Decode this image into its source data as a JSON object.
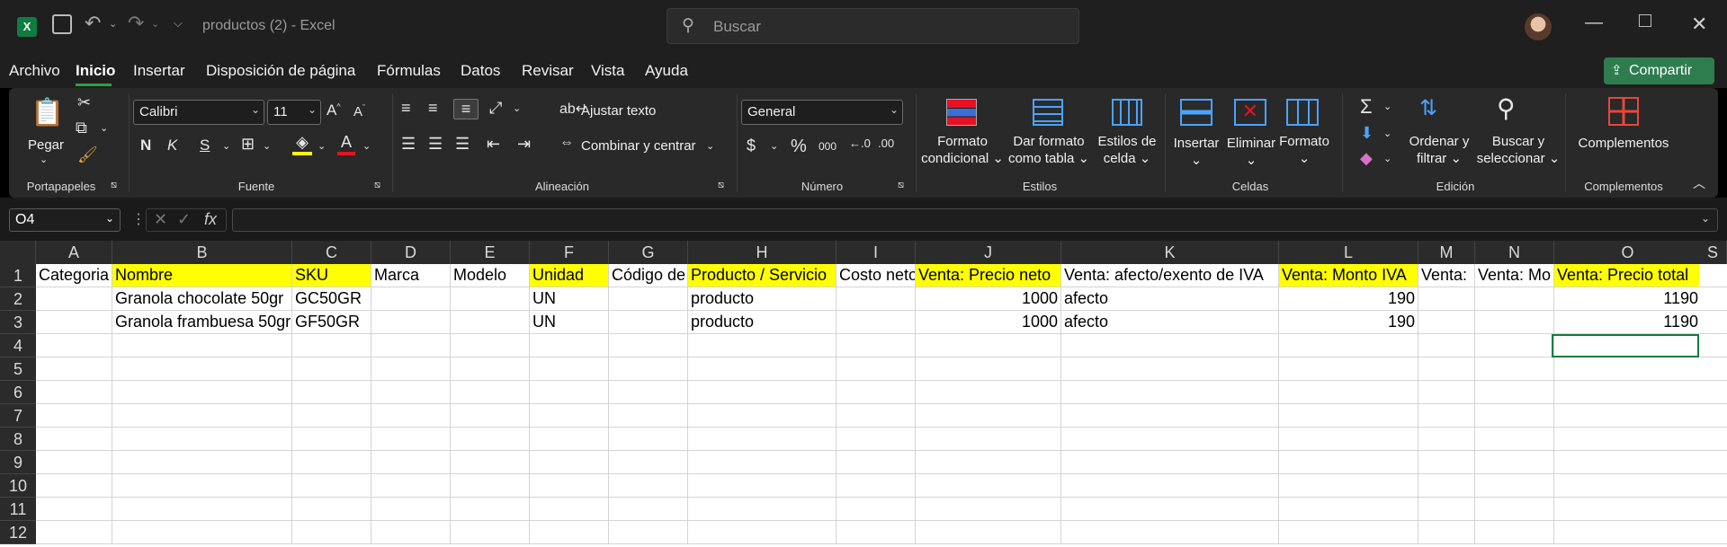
{
  "titlebar": {
    "doc_title": "productos (2)  -  Excel",
    "search_placeholder": "Buscar",
    "app_icon": "X"
  },
  "menu": [
    "Archivo",
    "Inicio",
    "Insertar",
    "Disposición de página",
    "Fórmulas",
    "Datos",
    "Revisar",
    "Vista",
    "Ayuda"
  ],
  "share_label": "Compartir",
  "ribbon": {
    "portapapeles": {
      "paste": "Pegar",
      "label": "Portapapeles"
    },
    "fuente": {
      "font": "Calibri",
      "size": "11",
      "label": "Fuente"
    },
    "alineacion": {
      "wrap": "Ajustar texto",
      "merge": "Combinar y centrar",
      "label": "Alineación"
    },
    "numero": {
      "format": "General",
      "label": "Número"
    },
    "estilos": {
      "cond1": "Formato",
      "cond2": "condicional",
      "table1": "Dar formato",
      "table2": "como tabla",
      "cell1": "Estilos de",
      "cell2": "celda",
      "label": "Estilos"
    },
    "celdas": {
      "insert": "Insertar",
      "delete": "Eliminar",
      "format": "Formato",
      "label": "Celdas"
    },
    "edicion": {
      "sort1": "Ordenar y",
      "sort2": "filtrar",
      "find1": "Buscar y",
      "find2": "seleccionar",
      "label": "Edición"
    },
    "complementos": {
      "btn": "Complementos",
      "label": "Complementos"
    }
  },
  "namebox": "O4",
  "formula_value": "",
  "columns": [
    "A",
    "B",
    "C",
    "D",
    "E",
    "F",
    "G",
    "H",
    "I",
    "J",
    "K",
    "L",
    "M",
    "N",
    "O"
  ],
  "rows": [
    "1",
    "2",
    "3",
    "4",
    "5",
    "6",
    "7",
    "8",
    "9",
    "10",
    "11",
    "12"
  ],
  "header_row": [
    "Categoria",
    "Nombre",
    "SKU",
    "Marca",
    "Modelo",
    "Unidad",
    "Código de",
    "Producto / Servicio",
    "Costo neto",
    "Venta: Precio neto",
    "Venta: afecto/exento de IVA",
    "Venta: Monto IVA",
    "Venta:",
    "Venta: Mo",
    "Venta: Precio total"
  ],
  "data_rows": [
    [
      "",
      "Granola chocolate 50gr",
      "GC50GR",
      "",
      "",
      "UN",
      "",
      "producto",
      "",
      "1000",
      "afecto",
      "190",
      "",
      "",
      "1190"
    ],
    [
      "",
      "Granola frambuesa 50gr",
      "GF50GR",
      "",
      "",
      "UN",
      "",
      "producto",
      "",
      "1000",
      "afecto",
      "190",
      "",
      "",
      "1190"
    ]
  ],
  "colors": {
    "excel_green": "#107c41",
    "highlight": "#ffff00",
    "share_bg": "#2e7d4f"
  }
}
